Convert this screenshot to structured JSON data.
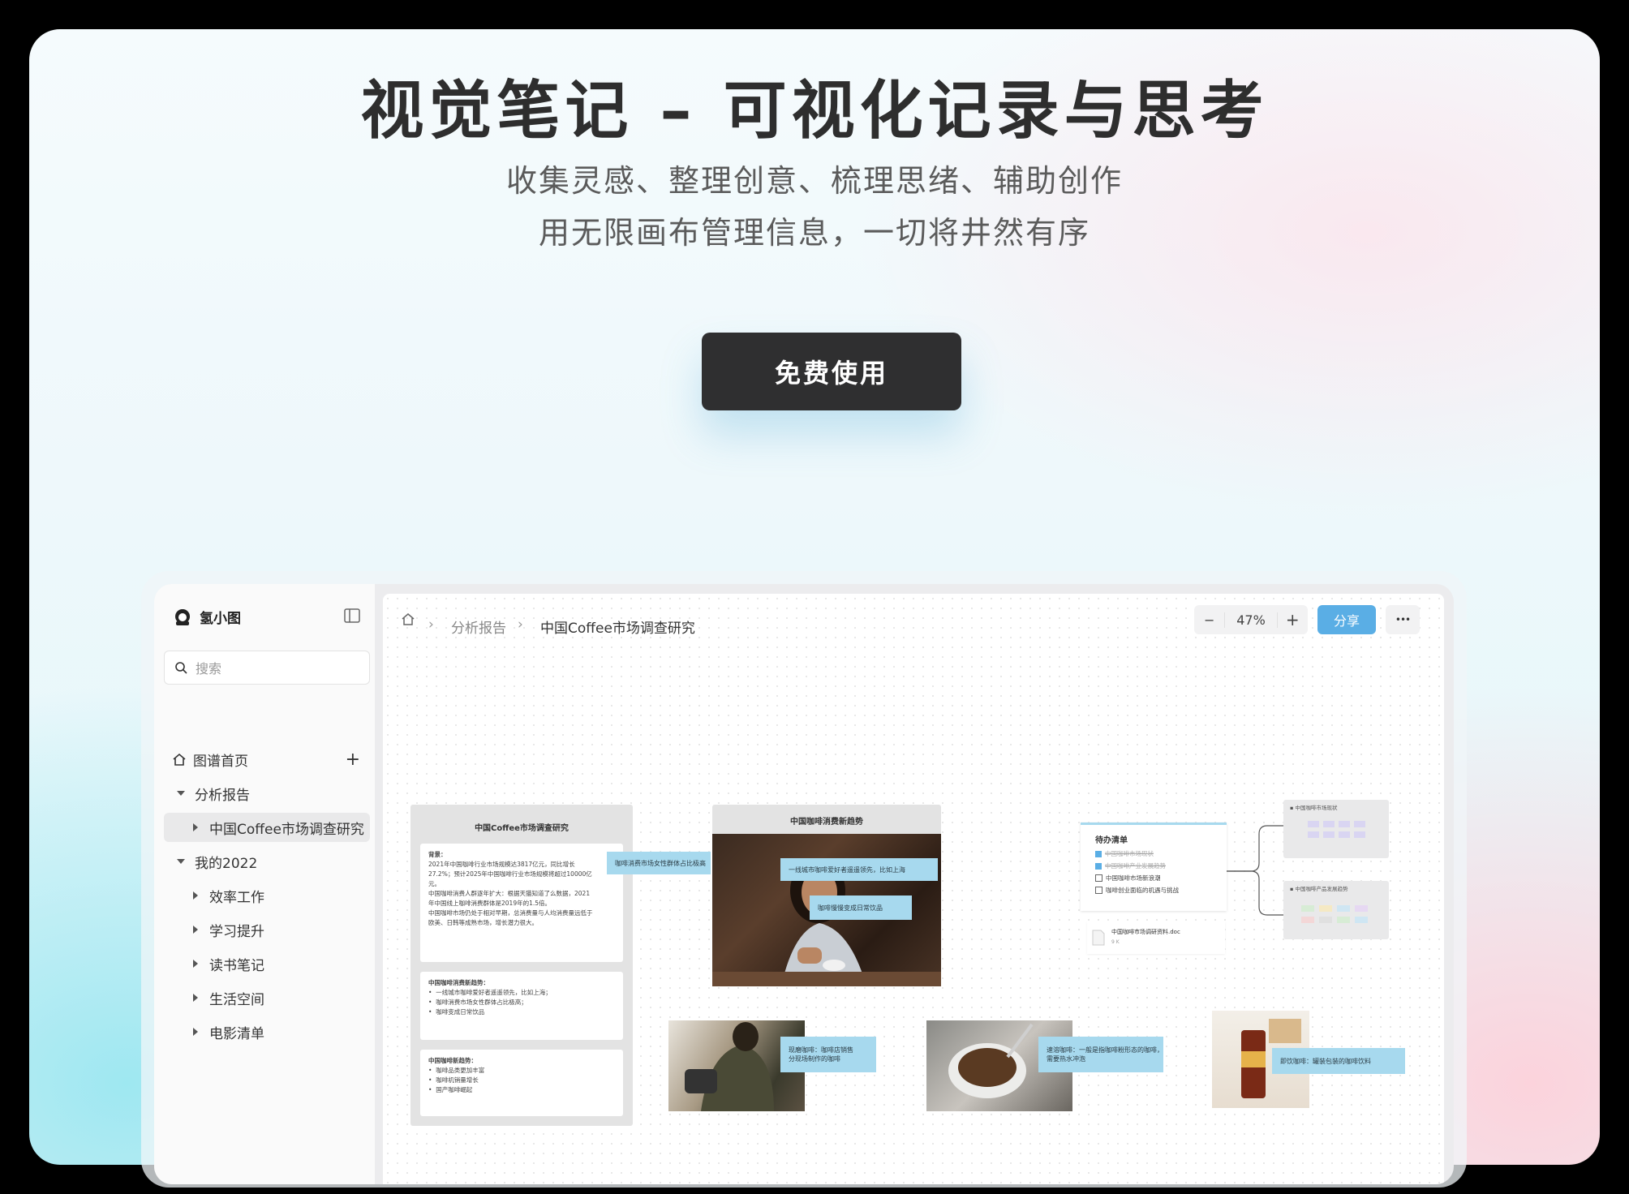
{
  "hero": {
    "title": "视觉笔记 – 可视化记录与思考",
    "subtitle_line1": "收集灵感、整理创意、梳理思绪、辅助创作",
    "subtitle_line2": "用无限画布管理信息，一切将井然有序",
    "cta_label": "免费使用"
  },
  "app": {
    "name": "氢小图",
    "search_placeholder": "搜索",
    "nav": {
      "home": "图谱首页",
      "analysis": "分析报告",
      "analysis_child": "中国Coffee市场调查研究",
      "mine": "我的2022",
      "children": [
        "效率工作",
        "学习提升",
        "读书笔记",
        "生活空间",
        "电影清单"
      ]
    },
    "breadcrumb": {
      "parent": "分析报告",
      "current": "中国Coffee市场调查研究"
    },
    "zoom": {
      "level": "47%",
      "minus": "−",
      "plus": "+"
    },
    "share_label": "分享",
    "more_label": "•••"
  },
  "canvas": {
    "doc_card": {
      "title": "中国Coffee市场调查研究",
      "s1_head": "背景：",
      "s1_lines": [
        "2021年中国咖啡行业市场规模达3817亿元，同比增长",
        "27.2%；预计2025年中国咖啡行业市场规模将超过10000亿",
        "元。",
        "中国咖啡消费人群逐年扩大：根据天猫知道了么数据，2021",
        "年中国线上咖啡消费群体是2019年的1.5倍。",
        "中国咖啡市场仍处于相对早期，总消费量与人均消费量远低于",
        "欧美、日韩等成熟市场，增长潜力很大。"
      ],
      "s2_head": "中国咖啡消费新趋势：",
      "s2_items": [
        "一线城市咖啡爱好者遥遥领先，比如上海；",
        "咖啡消费市场女性群体占比极高；",
        "咖啡变成日常饮品"
      ],
      "s3_head": "中国咖啡新趋势：",
      "s3_items": [
        "咖啡品类更加丰富",
        "咖啡机销量增长",
        "国产咖啡崛起"
      ]
    },
    "trend_card": {
      "title": "中国咖啡消费新趋势",
      "tag_left": "咖啡消费市场女性群体占比极高",
      "tag_right1": "一线城市咖啡爱好者遥遥领先，比如上海",
      "tag_right2": "咖啡慢慢变成日常饮品"
    },
    "todo": {
      "title": "待办清单",
      "items": [
        {
          "text": "中国咖啡市场现状",
          "done": true
        },
        {
          "text": "中国咖啡产业发展趋势",
          "done": true
        },
        {
          "text": "中国咖啡市场新浪潮",
          "done": false
        },
        {
          "text": "咖啡创业面临的机遇与挑战",
          "done": false
        }
      ]
    },
    "mini_cards": {
      "top": "中国咖啡市场现状",
      "bottom": "中国咖啡产品发展趋势"
    },
    "file": {
      "name": "中国咖啡市场调研资料.doc",
      "size": "9 K"
    },
    "photo_tags": {
      "p1": [
        "现磨咖啡：咖啡店销售",
        "分现场制作的咖啡"
      ],
      "p2": [
        "速溶咖啡：一般是指咖啡粉形态的咖啡，",
        "需要热水冲泡"
      ],
      "p3": [
        "即饮咖啡：罐装包装的咖啡饮料"
      ]
    }
  },
  "colors": {
    "accent": "#5aaee5",
    "cta": "#2f2f30",
    "tag": "#a7d9ee"
  }
}
